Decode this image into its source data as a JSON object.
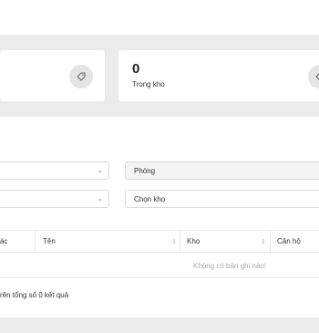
{
  "stats": {
    "left": {
      "icon": "tag-icon"
    },
    "right": {
      "value": "0",
      "label": "Trong kho",
      "icon": "tag-icon"
    }
  },
  "filters": {
    "left_select_1": {
      "value": "",
      "icon": "chevron-down-icon"
    },
    "left_select_2": {
      "value": "",
      "icon": "chevron-down-icon"
    },
    "room_select": {
      "value": "Phòng"
    },
    "warehouse_select": {
      "value": "Chọn kho"
    }
  },
  "table": {
    "columns": [
      "ác",
      "Tên",
      "Kho",
      "Căn hộ"
    ],
    "empty_text": "Không có bản ghi nào!"
  },
  "footer": {
    "summary": "rên tổng số 0 kết quả"
  }
}
